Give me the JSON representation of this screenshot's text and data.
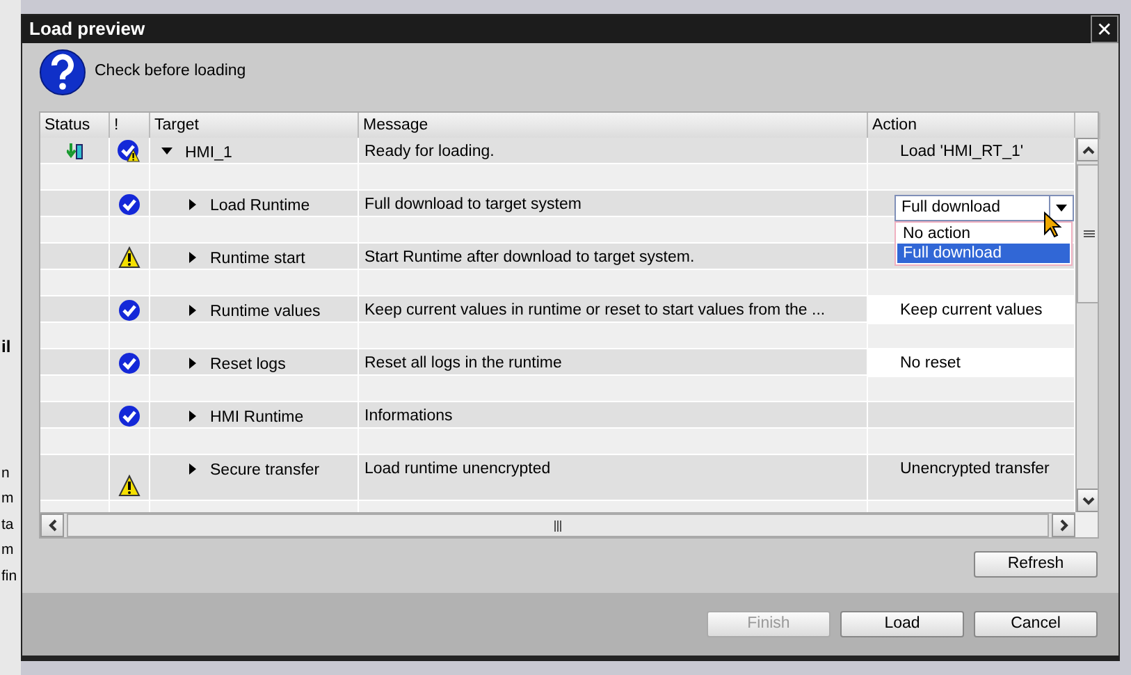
{
  "background": {
    "fragments": [
      {
        "text": "il",
        "bold": true
      },
      {
        "text": "n",
        "bold": false
      },
      {
        "text": "m",
        "bold": false
      },
      {
        "text": "ta",
        "bold": false
      },
      {
        "text": "m",
        "bold": false
      },
      {
        "text": "fin",
        "bold": false
      }
    ]
  },
  "window": {
    "title": "Load preview",
    "close": "✕"
  },
  "prompt": "Check before loading",
  "table": {
    "columns": [
      "Status",
      "!",
      "Target",
      "Message",
      "Action"
    ],
    "rows": [
      {
        "status": {
          "kind": "download"
        },
        "check": {
          "kind": "ok_warning"
        },
        "target": "HMI_1",
        "expanded": true,
        "message": "Ready for loading.",
        "action": {
          "kind": "text",
          "text": "Load 'HMI_RT_1'",
          "white": false
        },
        "children": [
          {
            "check": {
              "kind": "ok"
            },
            "target": "Load Runtime",
            "expanded": false,
            "message": "Full download to target system",
            "action": {
              "kind": "dropdown",
              "text": "Full download",
              "options": [
                {
                  "label": "No action",
                  "selected": false
                },
                {
                  "label": "Full download",
                  "selected": true
                }
              ]
            }
          },
          {
            "check": {
              "kind": "warning"
            },
            "target": "Runtime start",
            "expanded": false,
            "message": "Start Runtime after download to target system."
          },
          {
            "check": {
              "kind": "ok"
            },
            "target": "Runtime values",
            "expanded": false,
            "message": "Keep current values in runtime or reset to start values from the ...",
            "action": {
              "kind": "text",
              "text": "Keep current values",
              "white": true
            }
          },
          {
            "check": {
              "kind": "ok"
            },
            "target": "Reset logs",
            "expanded": false,
            "message": "Reset all logs in the runtime",
            "action": {
              "kind": "text",
              "text": "No reset",
              "white": true
            }
          },
          {
            "check": {
              "kind": "ok"
            },
            "target": "HMI Runtime",
            "expanded": false,
            "message": "Informations"
          },
          {
            "check": {
              "kind": "warning"
            },
            "target": "Secure transfer",
            "expanded": false,
            "message": "Load runtime unencrypted",
            "action": {
              "kind": "text",
              "text": "Unencrypted transfer",
              "white": false
            },
            "tall": true
          }
        ]
      }
    ]
  },
  "refresh": "Refresh",
  "buttons": [
    {
      "label": "Finish",
      "disabled": true
    },
    {
      "label": "Load",
      "disabled": false
    },
    {
      "label": "Cancel",
      "disabled": false
    }
  ]
}
